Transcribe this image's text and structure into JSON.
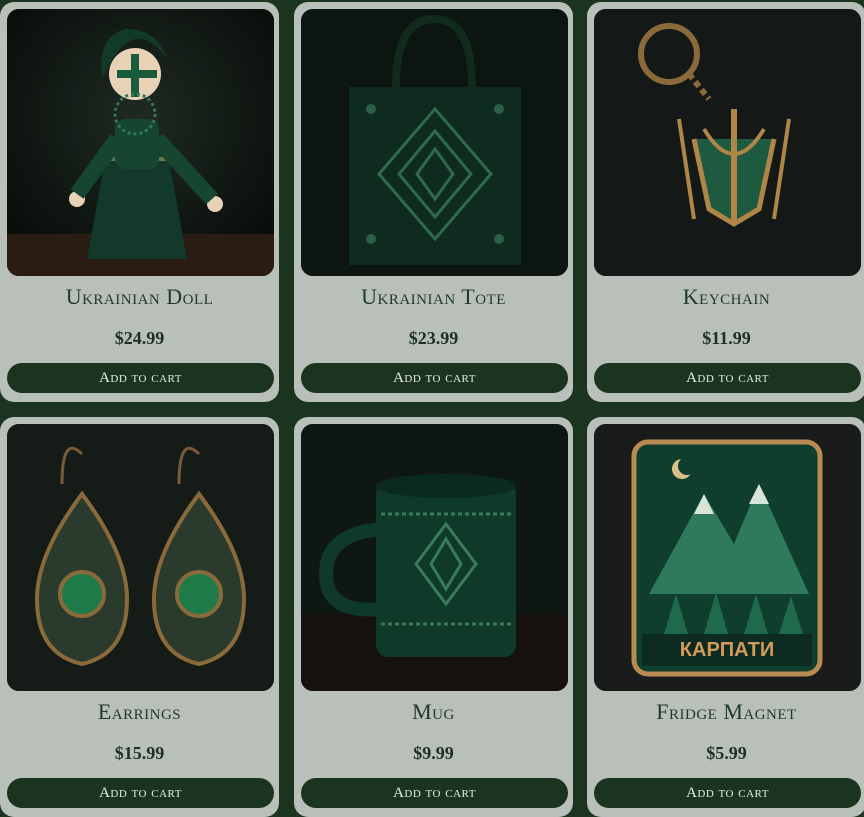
{
  "products": [
    {
      "title": "Ukrainian Doll",
      "price": "$24.99",
      "button": "Add to cart",
      "image": "motanka-doll"
    },
    {
      "title": "Ukrainian Tote",
      "price": "$23.99",
      "button": "Add to cart",
      "image": "embroidered-tote"
    },
    {
      "title": "Keychain",
      "price": "$11.99",
      "button": "Add to cart",
      "image": "trident-keychain"
    },
    {
      "title": "Earrings",
      "price": "$15.99",
      "button": "Add to cart",
      "image": "green-stone-earrings"
    },
    {
      "title": "Mug",
      "price": "$9.99",
      "button": "Add to cart",
      "image": "embroidered-mug"
    },
    {
      "title": "Fridge Magnet",
      "price": "$5.99",
      "button": "Add to cart",
      "image": "carpathians-magnet",
      "image_text": "КАРПАТИ"
    }
  ],
  "colors": {
    "page_bg": "#1b3420",
    "card_bg": "#b9c0b9",
    "button_bg": "#1b3420",
    "title": "#1f3a28"
  }
}
